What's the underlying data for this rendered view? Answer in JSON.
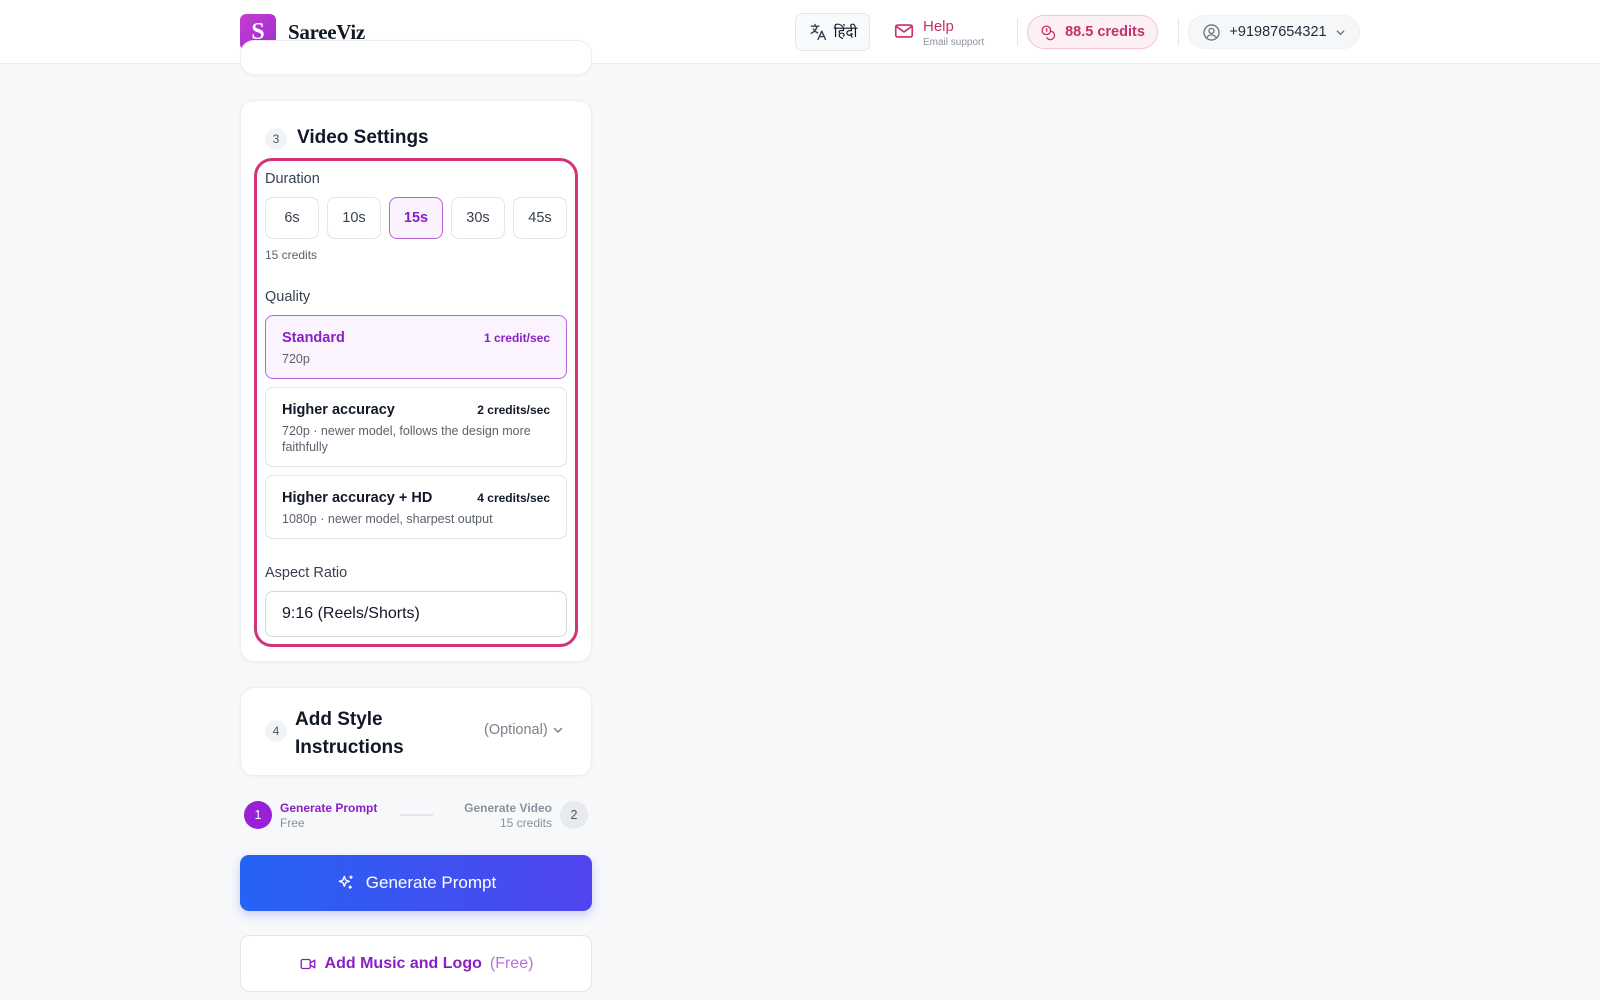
{
  "header": {
    "logo_letter": "S",
    "brand": "SareeViz",
    "language_label": "हिंदी",
    "help_title": "Help",
    "help_subtitle": "Email support",
    "credits": "88.5 credits",
    "user_phone": "+91987654321"
  },
  "video_settings": {
    "step": "3",
    "title": "Video Settings",
    "duration_label": "Duration",
    "durations": [
      "6s",
      "10s",
      "15s",
      "30s",
      "45s"
    ],
    "selected_duration": "15s",
    "duration_note": "15 credits",
    "quality_label": "Quality",
    "quality_options": [
      {
        "name": "Standard",
        "rate": "1 credit/sec",
        "desc": "720p",
        "selected": true
      },
      {
        "name": "Higher accuracy",
        "rate": "2 credits/sec",
        "desc": "720p · newer model, follows the design more faithfully",
        "selected": false
      },
      {
        "name": "Higher accuracy + HD",
        "rate": "4 credits/sec",
        "desc": "1080p · newer model, sharpest output",
        "selected": false
      }
    ],
    "aspect_label": "Aspect Ratio",
    "aspect_value": "9:16 (Reels/Shorts)"
  },
  "style_instructions": {
    "step": "4",
    "title_line1": "Add Style",
    "title_line2": "Instructions",
    "optional": "(Optional)"
  },
  "stepper": {
    "step1_num": "1",
    "step1_title": "Generate Prompt",
    "step1_sub": "Free",
    "step2_num": "2",
    "step2_title": "Generate Video",
    "step2_sub": "15 credits"
  },
  "actions": {
    "generate_prompt": "Generate Prompt",
    "add_music": "Add Music and Logo",
    "add_music_free": "(Free)"
  },
  "colors": {
    "accent_purple": "#8a1fc4",
    "highlight_pink": "#d2347a",
    "button_blue": "#2563f5"
  }
}
